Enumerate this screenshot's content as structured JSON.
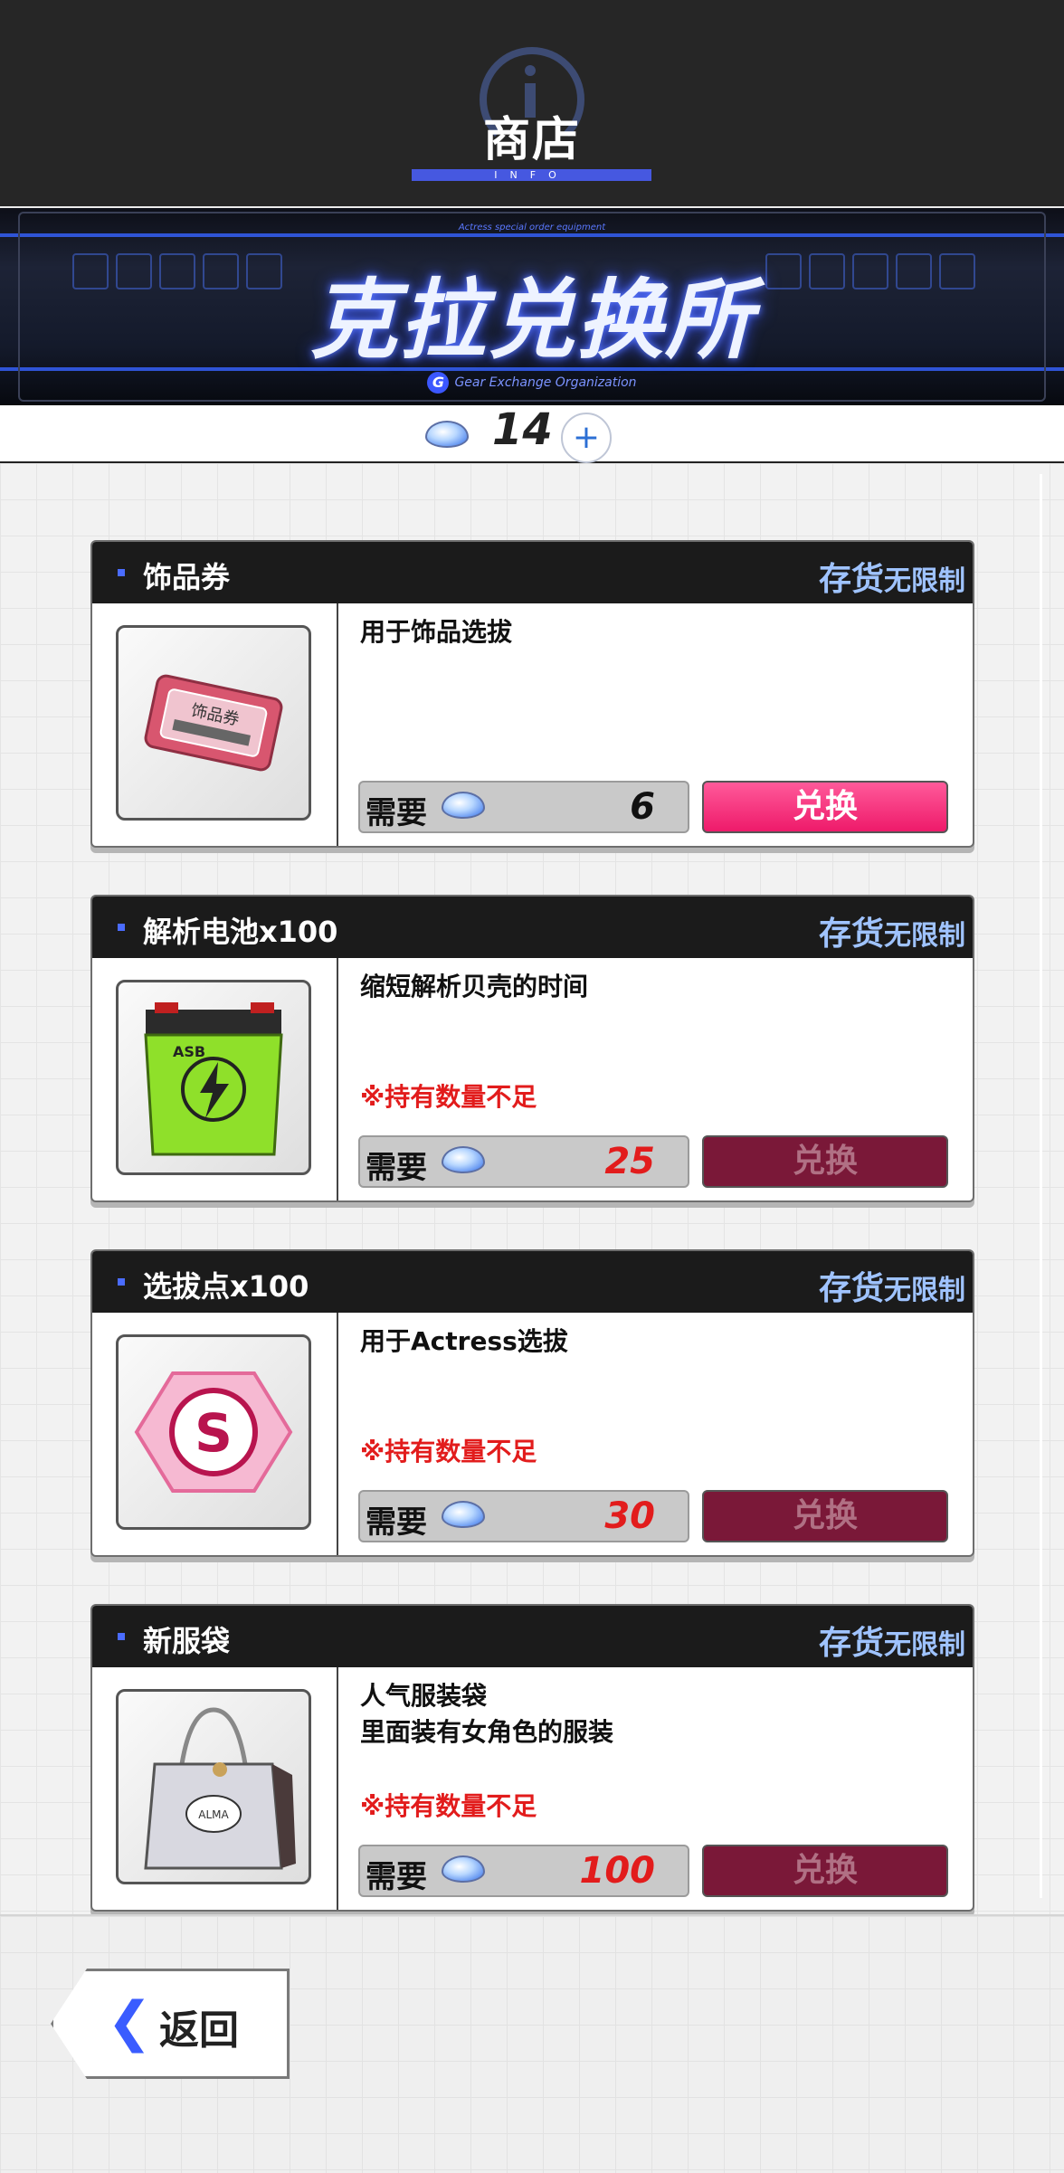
{
  "header": {
    "title": "商店",
    "subtitle": "INFO"
  },
  "banner": {
    "tagline": "Actress special order equipment",
    "title": "克拉兑换所",
    "org": "Gear Exchange Organization"
  },
  "currency": {
    "amount": "14",
    "icon": "gem-icon",
    "add": "+"
  },
  "items": [
    {
      "name": "饰品券",
      "stock_label": "存货",
      "stock_value": "无限制",
      "description": "用于饰品选拔",
      "warning": "",
      "cost_label": "需要",
      "cost": "6",
      "cost_color": "#111111",
      "button": "兑换",
      "enabled": true
    },
    {
      "name": "解析电池x100",
      "stock_label": "存货",
      "stock_value": "无限制",
      "description": "缩短解析贝壳的时间",
      "warning": "※持有数量不足",
      "cost_label": "需要",
      "cost": "25",
      "cost_color": "#e21c1c",
      "button": "兑换",
      "enabled": false
    },
    {
      "name": "选拔点x100",
      "stock_label": "存货",
      "stock_value": "无限制",
      "description": "用于Actress选拔",
      "warning": "※持有数量不足",
      "cost_label": "需要",
      "cost": "30",
      "cost_color": "#e21c1c",
      "button": "兑换",
      "enabled": false
    },
    {
      "name": "新服袋",
      "stock_label": "存货",
      "stock_value": "无限制",
      "description_line1": "人气服装袋",
      "description_line2": "里面装有女角色的服装",
      "warning": "※持有数量不足",
      "cost_label": "需要",
      "cost": "100",
      "cost_color": "#e21c1c",
      "button": "兑换",
      "enabled": false
    }
  ],
  "footer": {
    "back_label": "返回"
  },
  "colors": {
    "accent_blue": "#4658e0",
    "active_button": "#ee1a6a",
    "disabled_button": "#7a1838",
    "warning": "#e21c1c"
  }
}
